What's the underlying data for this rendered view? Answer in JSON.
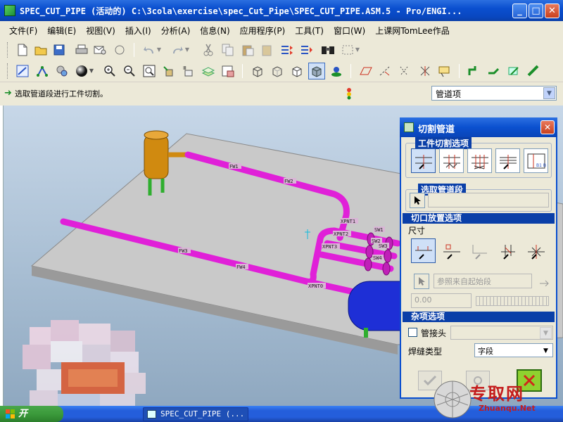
{
  "window": {
    "title": "SPEC_CUT_PIPE (活动的) C:\\3cola\\exercise\\spec_Cut_Pipe\\SPEC_CUT_PIPE.ASM.5 - Pro/ENGI...",
    "min_label": "_",
    "max_label": "□",
    "close_label": "✕"
  },
  "menu": {
    "items": [
      "文件(F)",
      "编辑(E)",
      "视图(V)",
      "插入(I)",
      "分析(A)",
      "信息(N)",
      "应用程序(P)",
      "工具(T)",
      "窗口(W)",
      "上课网TomLee作品"
    ]
  },
  "message": {
    "prompt": "选取管道段进行工件切割。",
    "filter_value": "管道项"
  },
  "model_labels": [
    "FW1",
    "FW2",
    "FW3",
    "FW4",
    "XPNT1",
    "XPNT2",
    "XPNT3",
    "XPNT0",
    "SW1",
    "SW2",
    "SW3",
    "SW4"
  ],
  "dialog": {
    "title": "切割管道",
    "close_label": "✕",
    "workpiece_group": "工件切割选项",
    "select_group": "选取管道段",
    "placement_section": "切口放置选项",
    "dimension_label": "尺寸",
    "reference_placeholder": "参照来自起始段",
    "value_placeholder": "0.00",
    "misc_section": "杂项选项",
    "fitting_label": "管接头",
    "weld_type_label": "焊缝类型",
    "weld_type_value": "字段",
    "ok_icon": "check-icon",
    "cancel_icon": "x-icon"
  },
  "taskbar": {
    "start_label": "开",
    "task_label": "SPEC_CUT_PIPE (..."
  },
  "watermark": {
    "text": "专取网",
    "sub": "Zhuanqu.Net"
  },
  "colors": {
    "pipe": "#e020d8",
    "tank_orange": "#d08a10",
    "tank_blue": "#1e2fd6",
    "base": "#c9c9c9",
    "titlebar": "#0a4fcf"
  }
}
